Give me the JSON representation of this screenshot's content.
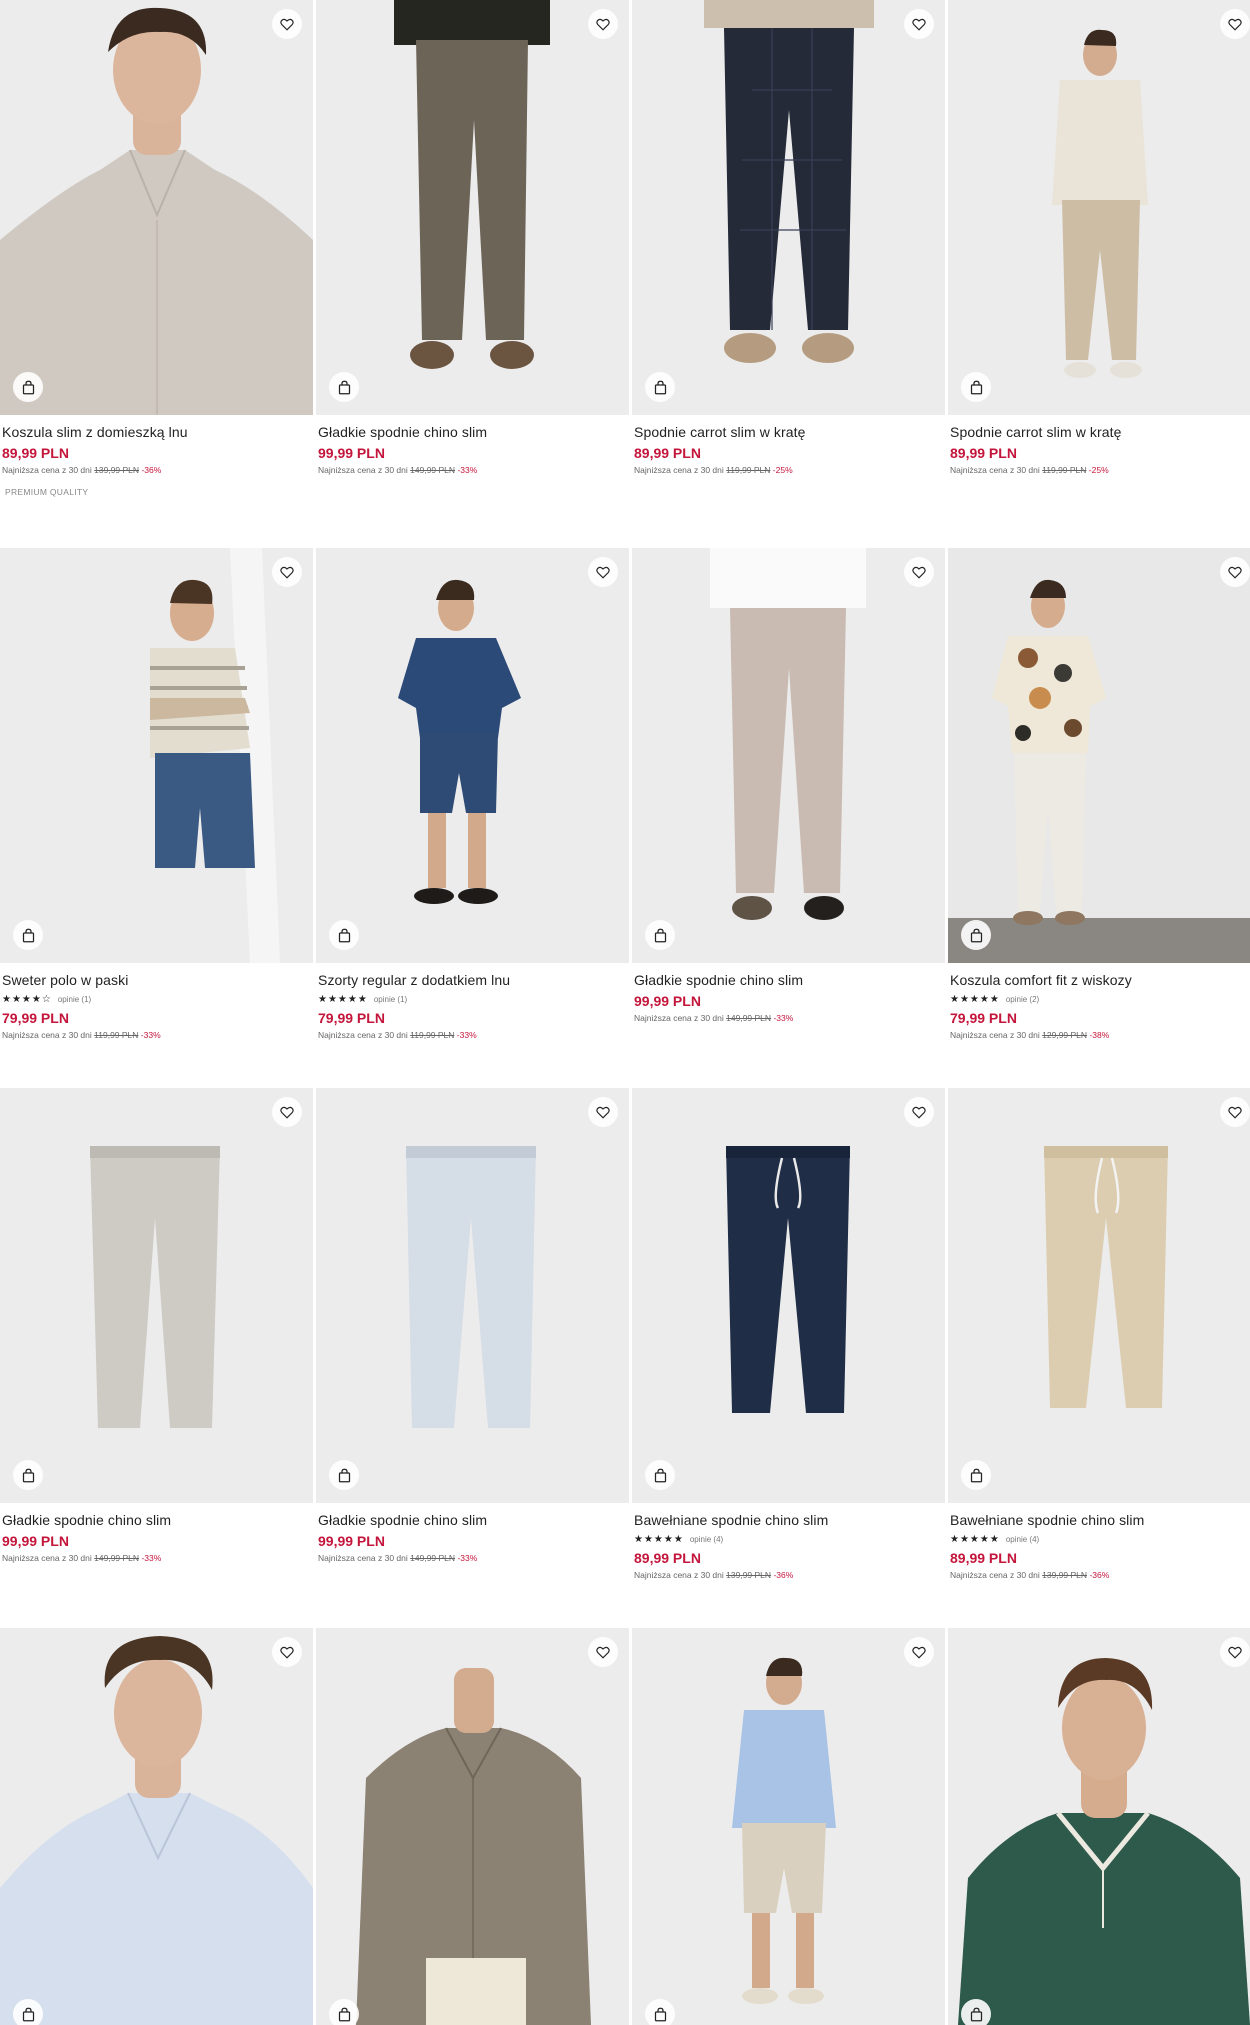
{
  "colors": {
    "price": "#c4153b",
    "text": "#222222",
    "muted": "#666666",
    "background": "#ffffff"
  },
  "icons": {
    "favorite": "heart-icon",
    "cart": "shopping-bag-icon"
  },
  "products": [
    {
      "name": "Koszula slim z domieszką lnu",
      "price": "89,99 PLN",
      "lowest_label": "Najniższa cena z 30 dni",
      "old_price": "139,99 PLN",
      "discount": "-36%",
      "badge": "PREMIUM QUALITY",
      "rating": null,
      "reviews": null
    },
    {
      "name": "Gładkie spodnie chino slim",
      "price": "99,99 PLN",
      "lowest_label": "Najniższa cena z 30 dni",
      "old_price": "149,99 PLN",
      "discount": "-33%",
      "badge": null,
      "rating": null,
      "reviews": null
    },
    {
      "name": "Spodnie carrot slim w kratę",
      "price": "89,99 PLN",
      "lowest_label": "Najniższa cena z 30 dni",
      "old_price": "119,99 PLN",
      "discount": "-25%",
      "badge": null,
      "rating": null,
      "reviews": null
    },
    {
      "name": "Spodnie carrot slim w kratę",
      "price": "89,99 PLN",
      "lowest_label": "Najniższa cena z 30 dni",
      "old_price": "119,99 PLN",
      "discount": "-25%",
      "badge": null,
      "rating": null,
      "reviews": null
    },
    {
      "name": "Sweter polo w paski",
      "price": "79,99 PLN",
      "lowest_label": "Najniższa cena z 30 dni",
      "old_price": "119,99 PLN",
      "discount": "-33%",
      "badge": null,
      "rating": "★★★★☆",
      "reviews": "opinie (1)"
    },
    {
      "name": "Szorty regular z dodatkiem lnu",
      "price": "79,99 PLN",
      "lowest_label": "Najniższa cena z 30 dni",
      "old_price": "119,99 PLN",
      "discount": "-33%",
      "badge": null,
      "rating": "★★★★★",
      "reviews": "opinie (1)"
    },
    {
      "name": "Gładkie spodnie chino slim",
      "price": "99,99 PLN",
      "lowest_label": "Najniższa cena z 30 dni",
      "old_price": "149,99 PLN",
      "discount": "-33%",
      "badge": null,
      "rating": null,
      "reviews": null
    },
    {
      "name": "Koszula comfort fit z wiskozy",
      "price": "79,99 PLN",
      "lowest_label": "Najniższa cena z 30 dni",
      "old_price": "129,99 PLN",
      "discount": "-38%",
      "badge": null,
      "rating": "★★★★★",
      "reviews": "opinie (2)"
    },
    {
      "name": "Gładkie spodnie chino slim",
      "price": "99,99 PLN",
      "lowest_label": "Najniższa cena z 30 dni",
      "old_price": "149,99 PLN",
      "discount": "-33%",
      "badge": null,
      "rating": null,
      "reviews": null
    },
    {
      "name": "Gładkie spodnie chino slim",
      "price": "99,99 PLN",
      "lowest_label": "Najniższa cena z 30 dni",
      "old_price": "149,99 PLN",
      "discount": "-33%",
      "badge": null,
      "rating": null,
      "reviews": null
    },
    {
      "name": "Bawełniane spodnie chino slim",
      "price": "89,99 PLN",
      "lowest_label": "Najniższa cena z 30 dni",
      "old_price": "139,99 PLN",
      "discount": "-36%",
      "badge": null,
      "rating": "★★★★★",
      "reviews": "opinie (4)"
    },
    {
      "name": "Bawełniane spodnie chino slim",
      "price": "89,99 PLN",
      "lowest_label": "Najniższa cena z 30 dni",
      "old_price": "139,99 PLN",
      "discount": "-36%",
      "badge": null,
      "rating": "★★★★★",
      "reviews": "opinie (4)"
    },
    {
      "name": null,
      "price": null,
      "lowest_label": null,
      "old_price": null,
      "discount": null,
      "badge": null,
      "rating": null,
      "reviews": null
    },
    {
      "name": null,
      "price": null,
      "lowest_label": null,
      "old_price": null,
      "discount": null,
      "badge": null,
      "rating": null,
      "reviews": null
    },
    {
      "name": null,
      "price": null,
      "lowest_label": null,
      "old_price": null,
      "discount": null,
      "badge": null,
      "rating": null,
      "reviews": null
    },
    {
      "name": null,
      "price": null,
      "lowest_label": null,
      "old_price": null,
      "discount": null,
      "badge": null,
      "rating": null,
      "reviews": null
    }
  ]
}
